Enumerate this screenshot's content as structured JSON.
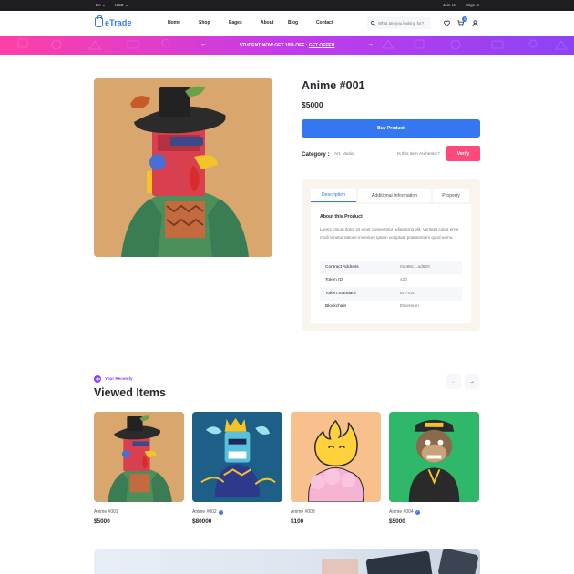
{
  "topbar": {
    "language": "En",
    "currency": "USD",
    "join": "Join Us",
    "signin": "Sign In"
  },
  "header": {
    "brand": "eTrade",
    "nav": [
      {
        "label": "Home",
        "dropdown": true
      },
      {
        "label": "Shop",
        "dropdown": true
      },
      {
        "label": "Pages",
        "dropdown": true
      },
      {
        "label": "About",
        "dropdown": false
      },
      {
        "label": "Blog",
        "dropdown": true
      },
      {
        "label": "Contact",
        "dropdown": false
      }
    ],
    "search_placeholder": "What are you looking for?",
    "cart_count": "0"
  },
  "promo": {
    "text": "STUDENT NOW GET 10% OFF : ",
    "link": "GET OFFER"
  },
  "product": {
    "title": "Anime #001",
    "price": "$5000",
    "buy_label": "Buy Product",
    "category_label": "Category :",
    "category_value": "Art, Music,",
    "authentic_question": "Is this item Authentic?",
    "verify_label": "Verify",
    "tabs": [
      "Description",
      "Additional Information",
      "Property"
    ],
    "about_title": "About this Product",
    "about_text": "Lorem ipsum dolor sit amet consectetur adipisicing elit. Veritatis culpa error modi tenetur ratione inventore ipsam voluptate praesentium quod nemo.",
    "specs": [
      {
        "key": "Contract Address",
        "value": "0xb86c...ad520"
      },
      {
        "key": "Token ID",
        "value": "420"
      },
      {
        "key": "Token Standard",
        "value": "Erc-420"
      },
      {
        "key": "Blockchain",
        "value": "Ethereum"
      }
    ]
  },
  "viewed": {
    "eyebrow": "Your Recently",
    "title": "Viewed Items",
    "items": [
      {
        "name": "Anime #001",
        "price": "$5000",
        "verified": false
      },
      {
        "name": "Anime #002",
        "price": "$80000",
        "verified": true
      },
      {
        "name": "Anime #003",
        "price": "$100",
        "verified": false
      },
      {
        "name": "Anime #004",
        "price": "$5000",
        "verified": true
      }
    ]
  },
  "colors": {
    "primary": "#3577f0",
    "verify": "#ff497c",
    "accent": "#8c43f5",
    "dark": "#292930"
  }
}
